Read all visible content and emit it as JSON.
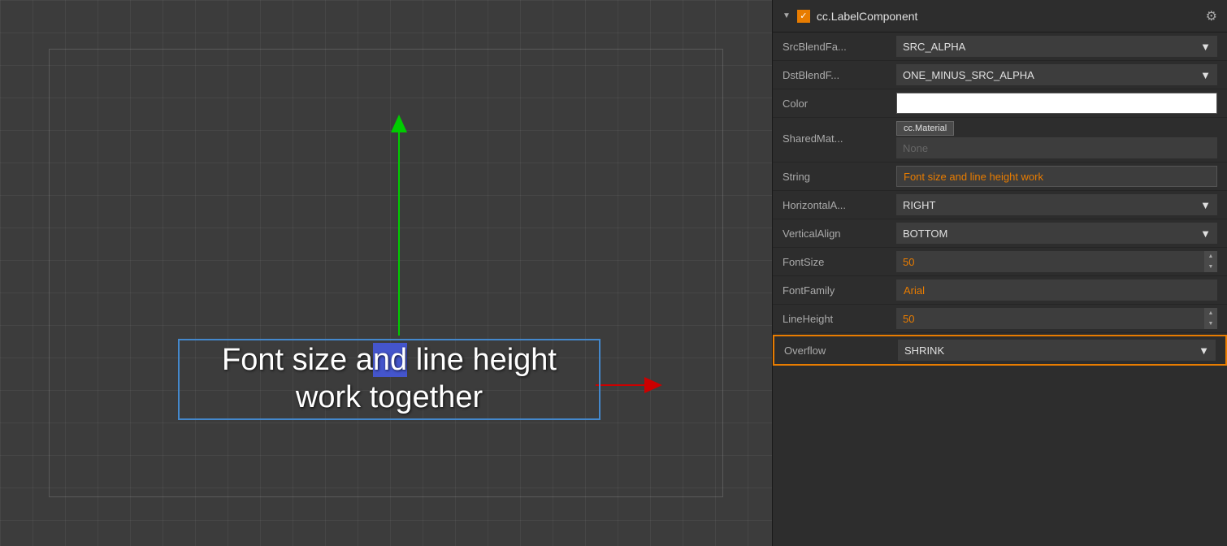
{
  "canvas": {
    "label_text_line1": "Font size a",
    "label_text_highlight": "nd",
    "label_text_line1_after": " line height",
    "label_text_line2": "work together"
  },
  "panel": {
    "header": {
      "title": "cc.LabelComponent",
      "gear_icon": "⚙",
      "check_icon": "✓",
      "arrow": "▼"
    },
    "rows": [
      {
        "label": "SrcBlendFa...",
        "type": "select",
        "value": "SRC_ALPHA"
      },
      {
        "label": "DstBlendF...",
        "type": "select",
        "value": "ONE_MINUS_SRC_ALPHA"
      },
      {
        "label": "Color",
        "type": "color",
        "value": "#ffffff"
      },
      {
        "label": "SharedMat...",
        "type": "sharedmat",
        "value": "None",
        "tab": "cc.Material"
      },
      {
        "label": "String",
        "type": "string",
        "value": "Font size and line height work"
      },
      {
        "label": "HorizontalA...",
        "type": "select",
        "value": "RIGHT"
      },
      {
        "label": "VerticalAlign",
        "type": "select",
        "value": "BOTTOM"
      },
      {
        "label": "FontSize",
        "type": "number",
        "value": "50"
      },
      {
        "label": "FontFamily",
        "type": "text",
        "value": "Arial"
      },
      {
        "label": "LineHeight",
        "type": "number",
        "value": "50"
      },
      {
        "label": "Overflow",
        "type": "select_overflow",
        "value": "SHRINK"
      }
    ]
  }
}
